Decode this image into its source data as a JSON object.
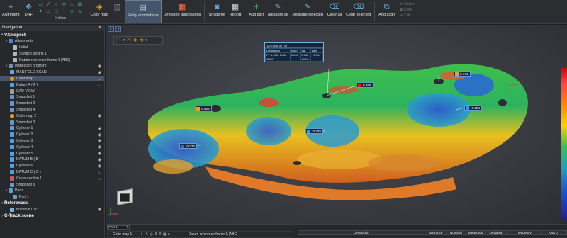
{
  "ribbon": {
    "alignment": "Alignment",
    "drf": "DRF",
    "entities": "Entities",
    "color_map": "Color map",
    "entity_annotations": "Entity annotations",
    "deviation_annotations": "Deviation annotations",
    "snapshot": "Snapshot",
    "report": "Report",
    "add_part": "Add part",
    "measure_all": "Measure all",
    "measure_selected": "Measure selected",
    "clear_all": "Clear all",
    "clear_selected": "Clear selected",
    "add_scan": "Add scan",
    "delete": "Delete",
    "copy": "Copy",
    "cut": "Cut"
  },
  "nav": {
    "title": "Navigation",
    "root": "VXinspect",
    "alignments": "Alignments",
    "initial": "Initial",
    "surface_best_fit": "Surface best fit 1",
    "datum_ref": "Datum reference frame 1 |ABC|",
    "inspection_program": "Inspection program",
    "items": [
      "MANIFOLD SCAN",
      "Color map 1",
      "Datum A ( A )",
      "CAD VIEW",
      "Snapshot 1",
      "Snapshot 2",
      "Snapshot 4",
      "Color map 2",
      "Snapshot 3",
      "Cylinder 1",
      "Cylinder 2",
      "Cylinder 3",
      "Cylinder 4",
      "Cylinder 5",
      "DATUM B ( B )",
      "Cylinder 6",
      "DATUM C ( C )",
      "Cross-section 1",
      "Snapshot 5"
    ],
    "parts": "Parts",
    "part1": "Part 1",
    "references": "References",
    "manifold": "manifold 0.03",
    "ctrack": "C-Track scene"
  },
  "viewport": {
    "labels": {
      "l1": "0.468",
      "l2": "0.171",
      "l3": "0.456",
      "l4": "-0.224",
      "l5": "-0.270",
      "l6": "-0.372"
    },
    "datum_card": {
      "title": "DATUM B ( B )",
      "h1": "Dimension",
      "h2": "Nom",
      "h3": "Val",
      "h4": "Dev",
      "r1a": "P +1.000 -1.000",
      "r1b": "0.400",
      "r1c": "0.006",
      "r1d": "+0.094",
      "r2a": "Ø  A/C",
      "r2b": "",
      "r2c": "+0.06",
      "r2d": ""
    }
  },
  "bottom": {
    "part": "Part 1",
    "color_map": "Color map 1",
    "datum_ref": "Datum reference frame 1 |ABC|",
    "columns": [
      "Dimension",
      "Tolerance",
      "Nominal",
      "Measured",
      "Deviation",
      "Tendency",
      "Out of"
    ]
  },
  "colors": {
    "accent": "#5fb3e6",
    "selection": "#46536a",
    "label_border": "#5aa0d8"
  }
}
